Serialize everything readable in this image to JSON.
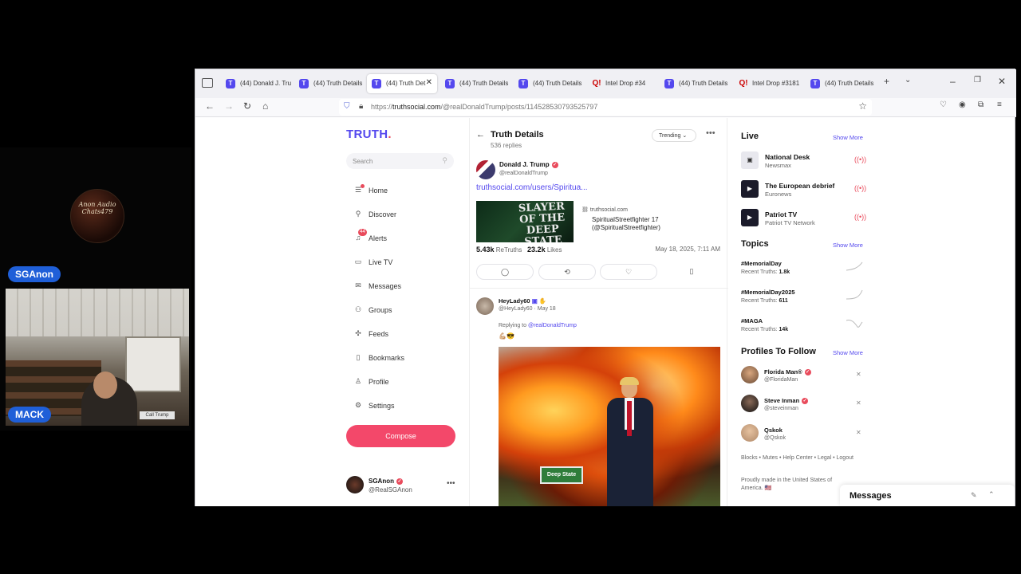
{
  "stream": {
    "logo_text": "Anon Audio Chats479",
    "badge_top": "SGAnon",
    "badge_bottom": "MACK",
    "webcam_sign": "Call Trump"
  },
  "browser": {
    "tabs": [
      {
        "label": "(44) Donald J. Tru",
        "favicon": "T"
      },
      {
        "label": "(44) Truth Details",
        "favicon": "T"
      },
      {
        "label": "(44) Truth Det",
        "favicon": "T",
        "active": true
      },
      {
        "label": "(44) Truth Details",
        "favicon": "T"
      },
      {
        "label": "(44) Truth Details",
        "favicon": "T"
      },
      {
        "label": "Intel Drop #34",
        "favicon": "Q!"
      },
      {
        "label": "(44) Truth Details",
        "favicon": "T"
      },
      {
        "label": "Intel Drop #3181",
        "favicon": "Q!"
      },
      {
        "label": "(44) Truth Details",
        "favicon": "T"
      }
    ],
    "url_prefix": "https://",
    "url_domain": "truthsocial.com",
    "url_path": "/@realDonaldTrump/posts/114528530793525797"
  },
  "sidebar": {
    "logo": "TRUTH",
    "logo_dot": ".",
    "search_placeholder": "Search",
    "nav": [
      {
        "label": "Home",
        "icon": "home-icon"
      },
      {
        "label": "Discover",
        "icon": "discover-icon"
      },
      {
        "label": "Alerts",
        "icon": "alerts-icon",
        "badge": "44"
      },
      {
        "label": "Live TV",
        "icon": "tv-icon"
      },
      {
        "label": "Messages",
        "icon": "messages-icon"
      },
      {
        "label": "Groups",
        "icon": "groups-icon"
      },
      {
        "label": "Feeds",
        "icon": "feeds-icon"
      },
      {
        "label": "Bookmarks",
        "icon": "bookmark-icon"
      },
      {
        "label": "Profile",
        "icon": "profile-icon"
      },
      {
        "label": "Settings",
        "icon": "settings-icon"
      }
    ],
    "compose_label": "Compose",
    "me": {
      "name": "SGAnon",
      "handle": "@RealSGAnon"
    }
  },
  "main": {
    "title": "Truth Details",
    "subtitle": "536 replies",
    "sort_label": "Trending",
    "post": {
      "author": "Donald J. Trump",
      "handle": "@realDonaldTrump",
      "link_text": "truthsocial.com/users/Spiritua...",
      "card_image_text": "SLAYER OF THE DEEP STATE",
      "card_domain": "truthsocial.com",
      "card_title": "SpiritualStreetfighter 17 (@SpiritualStreetfighter)",
      "retruths": "5.43k",
      "retruths_label": "ReTruths",
      "likes": "23.2k",
      "likes_label": "Likes",
      "date": "May 18, 2025, 7:11 AM"
    },
    "reply": {
      "author": "HeyLady60",
      "handle": "@HeyLady60 · May 18",
      "replying_prefix": "Replying to ",
      "replying_to": "@realDonaldTrump",
      "emoji": "💪🏼😎",
      "sign_text": "Deep State"
    }
  },
  "right": {
    "live_heading": "Live",
    "show_more": "Show More",
    "live": [
      {
        "title": "National Desk",
        "source": "Newsmax"
      },
      {
        "title": "The European debrief",
        "source": "Euronews"
      },
      {
        "title": "Patriot TV",
        "source": "Patriot TV Network"
      }
    ],
    "topics_heading": "Topics",
    "topics_count_label": "Recent Truths:",
    "topics": [
      {
        "name": "#MemorialDay",
        "count": "1.8k"
      },
      {
        "name": "#MemorialDay2025",
        "count": "611"
      },
      {
        "name": "#MAGA",
        "count": "14k"
      }
    ],
    "follow_heading": "Profiles To Follow",
    "follow": [
      {
        "name": "Florida Man®",
        "handle": "@FloridaMan"
      },
      {
        "name": "Steve Inman",
        "handle": "@steveinman"
      },
      {
        "name": "Qskok",
        "handle": "@Qskok"
      }
    ],
    "footer_links": "Blocks • Mutes • Help Center • Legal • Logout",
    "made_in": "Proudly made in the United States of America. 🇺🇸",
    "messages_label": "Messages"
  },
  "colors": {
    "brand": "#5448ee",
    "accent": "#f3486a"
  }
}
